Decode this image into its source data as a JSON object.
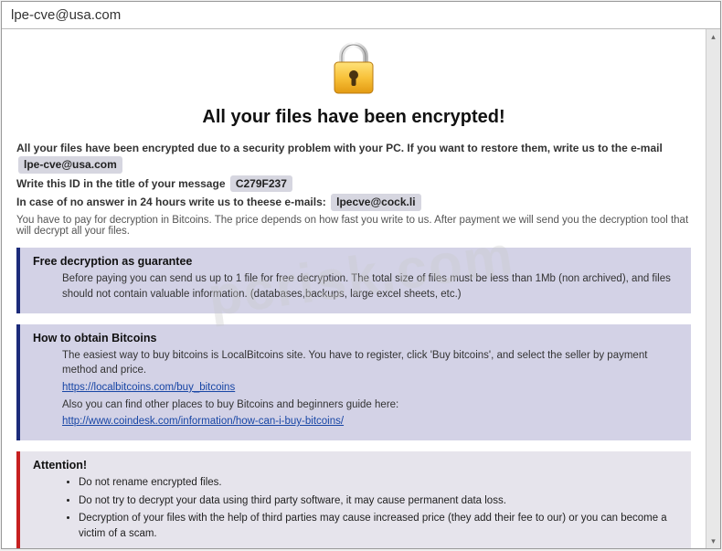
{
  "window": {
    "title": "lpe-cve@usa.com"
  },
  "heading": "All your files have been encrypted!",
  "intro": {
    "line1_a": "All your files have been encrypted due to a security problem with your PC. If you want to restore them, write us to the e-mail",
    "email1": "lpe-cve@usa.com",
    "line2_a": "Write this ID in the title of your message",
    "id": "C279F237",
    "line3_a": "In case of no answer in 24 hours write us to theese e-mails:",
    "email2": "lpecve@cock.li",
    "subnote": "You have to pay for decryption in Bitcoins. The price depends on how fast you write to us. After payment we will send you the decryption tool that will decrypt all your files."
  },
  "sections": {
    "guarantee": {
      "title": "Free decryption as guarantee",
      "body": "Before paying you can send us up to 1 file for free decryption. The total size of files must be less than 1Mb (non archived), and files should not contain valuable information. (databases,backups, large excel sheets, etc.)"
    },
    "bitcoins": {
      "title": "How to obtain Bitcoins",
      "body1": "The easiest way to buy bitcoins is LocalBitcoins site. You have to register, click 'Buy bitcoins', and select the seller by payment method and price.",
      "link1": "https://localbitcoins.com/buy_bitcoins",
      "body2": "Also you can find other places to buy Bitcoins and beginners guide here:",
      "link2": "http://www.coindesk.com/information/how-can-i-buy-bitcoins/"
    },
    "attention": {
      "title": "Attention!",
      "items": [
        "Do not rename encrypted files.",
        "Do not try to decrypt your data using third party software, it may cause permanent data loss.",
        "Decryption of your files with the help of third parties may cause increased price (they add their fee to our) or you can become a victim of a scam."
      ]
    }
  },
  "watermark": "pcrisk.com"
}
